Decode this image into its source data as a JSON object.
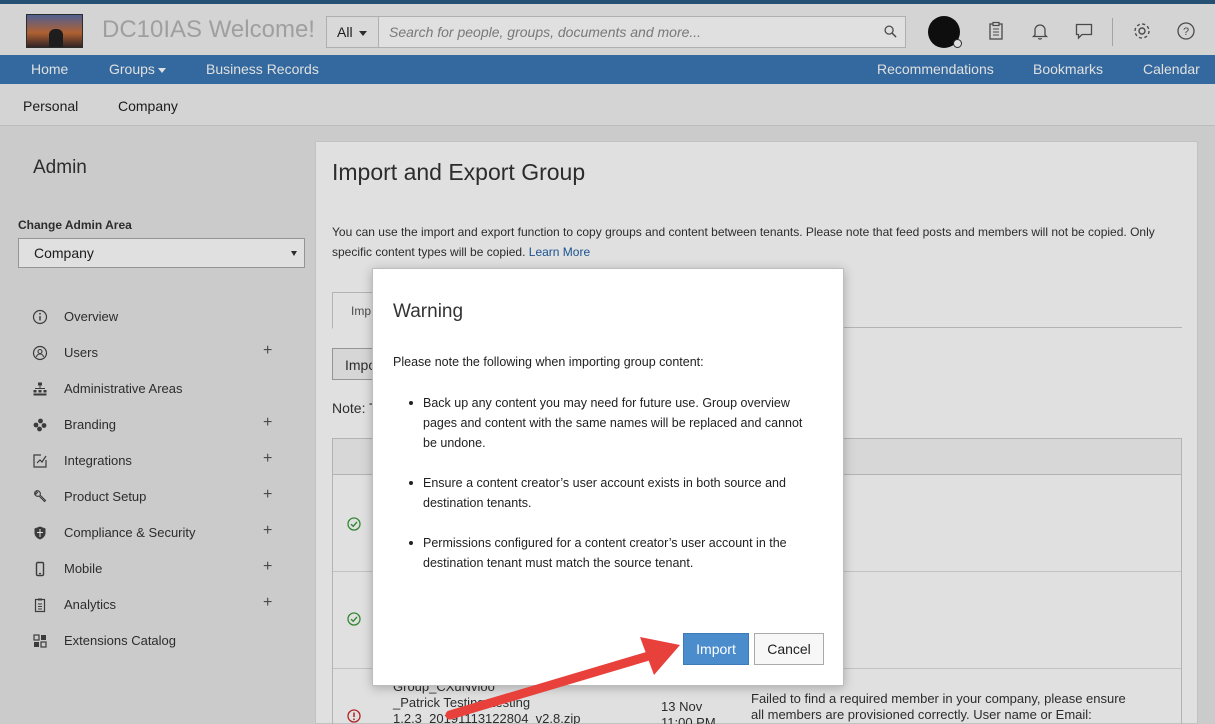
{
  "header": {
    "app_title": "DC10IAS Welcome!",
    "search_scope": "All",
    "search_placeholder": "Search for people, groups, documents and more...",
    "icons": [
      "search-icon",
      "avatar",
      "clipboard-icon",
      "bell-icon",
      "chat-icon",
      "gear-icon",
      "help-icon"
    ]
  },
  "nav": {
    "home": "Home",
    "groups": "Groups",
    "business_records": "Business Records",
    "recommendations": "Recommendations",
    "bookmarks": "Bookmarks",
    "calendar": "Calendar"
  },
  "subnav": {
    "personal": "Personal",
    "company": "Company"
  },
  "sidebar": {
    "title": "Admin",
    "change_label": "Change Admin Area",
    "selected_area": "Company",
    "items": [
      {
        "label": "Overview",
        "icon": "info-icon",
        "expandable": false
      },
      {
        "label": "Users",
        "icon": "user-icon",
        "expandable": true
      },
      {
        "label": "Administrative Areas",
        "icon": "hierarchy-icon",
        "expandable": false
      },
      {
        "label": "Branding",
        "icon": "palette-icon",
        "expandable": true
      },
      {
        "label": "Integrations",
        "icon": "integrations-icon",
        "expandable": true
      },
      {
        "label": "Product Setup",
        "icon": "wrench-icon",
        "expandable": true
      },
      {
        "label": "Compliance & Security",
        "icon": "shield-icon",
        "expandable": true
      },
      {
        "label": "Mobile",
        "icon": "mobile-icon",
        "expandable": true
      },
      {
        "label": "Analytics",
        "icon": "report-icon",
        "expandable": true
      },
      {
        "label": "Extensions Catalog",
        "icon": "catalog-icon",
        "expandable": false
      }
    ],
    "plus": "+"
  },
  "main": {
    "title": "Import and Export Group",
    "intro_text": "You can use the import and export function to copy groups and content between tenants. Please note that feed posts and members will not be copied. Only specific content types will be copied.",
    "learn_more": "Learn More",
    "tab_label": "Imp",
    "import_button_partial": "Impo",
    "note_partial": "Note: T",
    "last_row": {
      "file_lines": [
        "Group_CXuNvioo",
        "_Patrick Testing, testing",
        "1.2.3_20191113122804_v2.8.zip"
      ],
      "date_lines": [
        "13 Nov",
        "11:00 PM"
      ],
      "message_lines": [
        "Failed to find a required member in your company, please ensure",
        "all members are provisioned correctly. User name or Email:"
      ]
    }
  },
  "modal": {
    "title": "Warning",
    "intro": "Please note the following when importing group content:",
    "bullets": [
      "Back up any content you may need for future use. Group overview pages and content with the same names will be replaced and cannot be undone.",
      "Ensure a content creator’s user account exists in both source and destination tenants.",
      "Permissions configured for a content creator’s user account in the destination tenant must match the source tenant."
    ],
    "import_label": "Import",
    "cancel_label": "Cancel"
  },
  "colors": {
    "nav_blue": "#3b78b4",
    "primary_button": "#4a8ccc",
    "success_green": "#3a9a3a",
    "error_red": "#c8282a",
    "annotation_arrow": "#e8403a"
  }
}
